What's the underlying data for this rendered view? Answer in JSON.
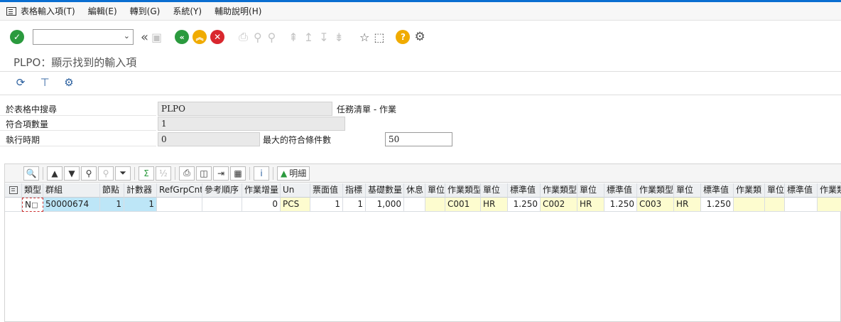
{
  "menu": [
    "表格輸入項(T)",
    "編輯(E)",
    "轉到(G)",
    "系統(Y)",
    "輔助說明(H)"
  ],
  "toolbar": {
    "command_field": ""
  },
  "title": "PLPO：顯示找到的輸入項",
  "form": {
    "table_label": "於表格中搜尋",
    "table_value": "PLPO",
    "table_desc": "任務清單 - 作業",
    "hits_label": "符合項數量",
    "hits_value": "1",
    "runtime_label": "執行時期",
    "runtime_value": "0",
    "maxhits_label": "最大的符合條件數",
    "maxhits_value": "50"
  },
  "grid_toolbar": {
    "detail_label": "明細"
  },
  "table": {
    "headers": [
      "類型",
      "群組",
      "節點",
      "計數器",
      "RefGrpCntr",
      "參考順序",
      "作業增量",
      "Un",
      "票面值",
      "指標",
      "基礎數量",
      "休息",
      "單位",
      "作業類型",
      "單位",
      "標準值",
      "作業類型",
      "單位",
      "標準值",
      "作業類型",
      "單位",
      "標準值",
      "作業類",
      "單位",
      "標準值",
      "作業類"
    ],
    "row": [
      "N",
      "50000674",
      "1",
      "1",
      "",
      "",
      "0",
      "PCS",
      "1",
      "1",
      "1,000",
      "",
      "",
      "C001",
      "HR",
      "1.250",
      "C002",
      "HR",
      "1.250",
      "C003",
      "HR",
      "1.250",
      "",
      "",
      "",
      ""
    ]
  }
}
